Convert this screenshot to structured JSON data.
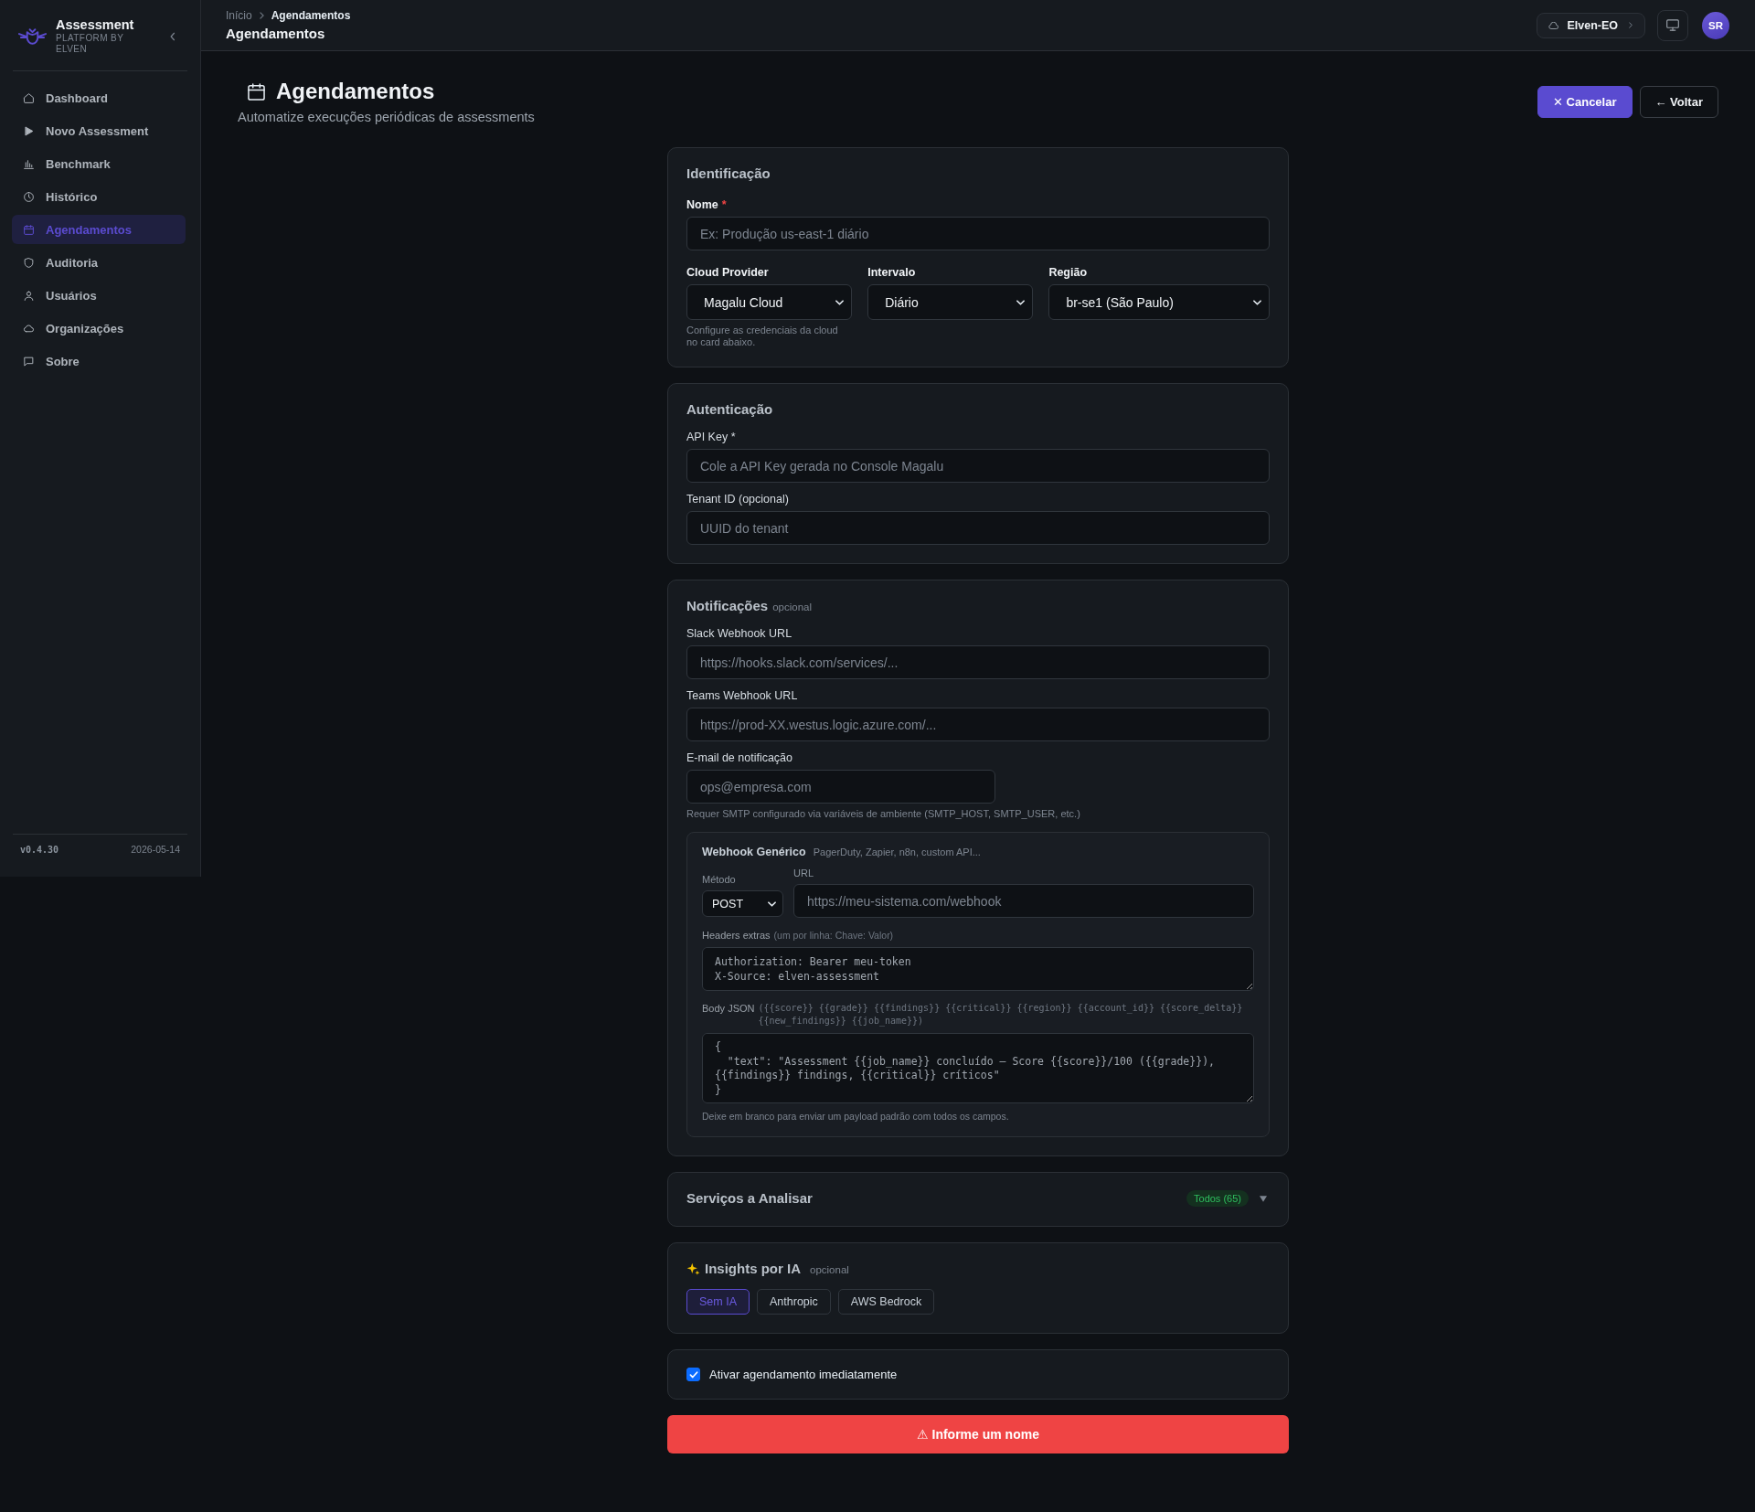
{
  "sidebar": {
    "brand": {
      "name": "Assessment",
      "subtitle": "PLATFORM BY ELVEN"
    },
    "items": [
      {
        "label": "Dashboard",
        "selected": false
      },
      {
        "label": "Novo Assessment",
        "selected": false
      },
      {
        "label": "Benchmark",
        "selected": false
      },
      {
        "label": "Histórico",
        "selected": false
      },
      {
        "label": "Agendamentos",
        "selected": true
      },
      {
        "label": "Auditoria",
        "selected": false
      },
      {
        "label": "Usuários",
        "selected": false
      },
      {
        "label": "Organizações",
        "selected": false
      },
      {
        "label": "Sobre",
        "selected": false
      }
    ],
    "version": "v0.4.30",
    "date": "2026-05-14"
  },
  "topbar": {
    "breadcrumb": [
      {
        "label": "Início",
        "current": false
      },
      {
        "label": "Agendamentos",
        "current": true
      }
    ],
    "title": "Agendamentos",
    "organization": "Elven-EO",
    "avatar": "SR"
  },
  "page_header": {
    "title": "Agendamentos",
    "subtitle": "Automatize execuções periódicas de assessments",
    "buttons": [
      {
        "label": "✕ Cancelar",
        "kind": "primary"
      },
      {
        "label": "← Voltar",
        "kind": "outline"
      }
    ]
  },
  "identification": {
    "title": "Identificação",
    "name_field": {
      "label": "Nome",
      "required_mark": "*",
      "placeholder": "Ex: Produção us-east-1 diário"
    },
    "selects": [
      {
        "label": "Cloud Provider",
        "value": "Magalu Cloud",
        "help": "Configure as credenciais da cloud no card abaixo."
      },
      {
        "label": "Intervalo",
        "value": "Diário"
      },
      {
        "label": "Região",
        "value": "br-se1 (São Paulo)"
      }
    ]
  },
  "authentication": {
    "title": "Autenticação",
    "fields": [
      {
        "label": "API Key *",
        "placeholder": "Cole a API Key gerada no Console Magalu"
      },
      {
        "label": "Tenant ID (opcional)",
        "placeholder": "UUID do tenant"
      }
    ]
  },
  "notifications": {
    "title": "Notificações",
    "tag": "opcional",
    "url_fields": [
      {
        "label": "Slack Webhook URL",
        "placeholder": "https://hooks.slack.com/services/..."
      },
      {
        "label": "Teams Webhook URL",
        "placeholder": "https://prod-XX.westus.logic.azure.com/..."
      }
    ],
    "email_field": {
      "label": "E-mail de notificação",
      "placeholder": "ops@empresa.com",
      "help": "Requer SMTP configurado via variáveis de ambiente (SMTP_HOST, SMTP_USER, etc.)"
    },
    "webhook": {
      "title": "Webhook Genérico",
      "subtitle": "PagerDuty, Zapier, n8n, custom API...",
      "method": {
        "label": "Método",
        "value": "POST"
      },
      "url": {
        "label": "URL",
        "placeholder": "https://meu-sistema.com/webhook"
      },
      "headers": {
        "label": "Headers extras",
        "hint": "(um por linha: Chave: Valor)",
        "placeholder": "Authorization: Bearer meu-token\nX-Source: elven-assessment"
      },
      "body": {
        "label": "Body JSON",
        "hint": "({{score}} {{grade}} {{findings}} {{critical}} {{region}} {{account_id}} {{score_delta}} {{new_findings}} {{job_name}})",
        "placeholder": "{\n  \"text\": \"Assessment {{job_name}} concluído — Score {{score}}/100 ({{grade}}), {{findings}} findings, {{critical}} críticos\"\n}",
        "help": "Deixe em branco para enviar um payload padrão com todos os campos."
      }
    }
  },
  "services": {
    "title": "Serviços a Analisar",
    "badge": "Todos (65)",
    "expanded": false
  },
  "ai_insights": {
    "title": "Insights por IA",
    "tag": "opcional",
    "options": [
      {
        "label": "Sem IA",
        "selected": true
      },
      {
        "label": "Anthropic",
        "selected": false
      },
      {
        "label": "AWS Bedrock",
        "selected": false
      }
    ]
  },
  "activation": {
    "label": "Ativar agendamento imediatamente",
    "checked": true
  },
  "submit": {
    "label": "⚠ Informe um nome"
  }
}
